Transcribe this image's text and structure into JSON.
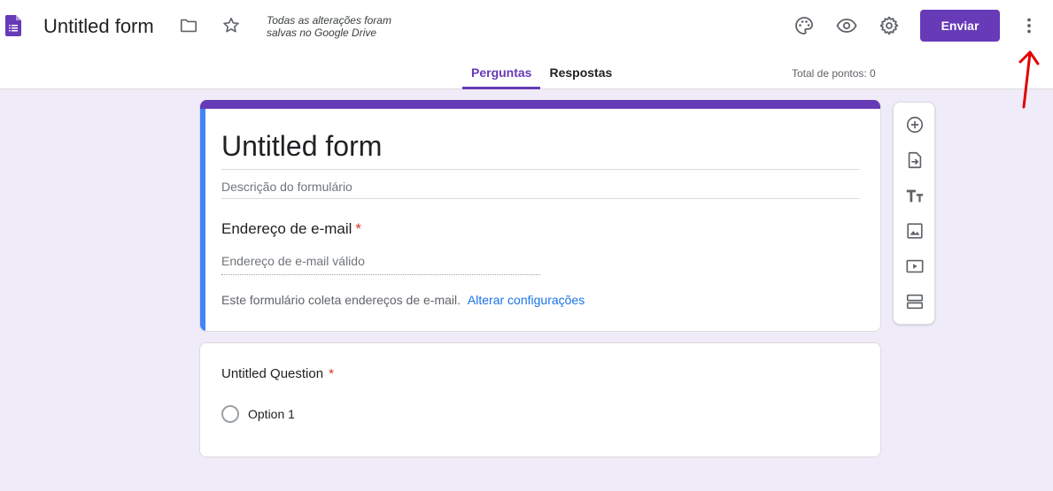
{
  "header": {
    "title": "Untitled form",
    "save_status_line1": "Todas as alterações foram",
    "save_status_line2": "salvas no Google Drive",
    "send_label": "Enviar",
    "icons": [
      "forms-logo-icon",
      "folder-icon",
      "star-icon",
      "palette-icon",
      "eye-icon",
      "gear-icon",
      "more-vert-icon"
    ]
  },
  "tabs": [
    {
      "label": "Perguntas",
      "active": true
    },
    {
      "label": "Respostas",
      "active": false
    }
  ],
  "total_points": "Total de pontos: 0",
  "form": {
    "title": "Untitled form",
    "description_placeholder": "Descrição do formulário",
    "email_label": "Endereço de e-mail",
    "email_placeholder": "Endereço de e-mail válido",
    "collect_note": "Este formulário coleta endereços de e-mail.",
    "change_settings_link": "Alterar configurações"
  },
  "question": {
    "title": "Untitled Question",
    "required_mark": "*",
    "options": [
      "Option 1"
    ]
  },
  "toolbar_icons": [
    "add-circle-icon",
    "import-icon",
    "text-icon",
    "image-icon",
    "video-icon",
    "section-icon"
  ],
  "colors": {
    "accent": "#673ab7",
    "background": "#f0ebf8",
    "left_bar": "#4285f4",
    "link": "#1a73e8",
    "annotation_arrow": "#e00000"
  }
}
